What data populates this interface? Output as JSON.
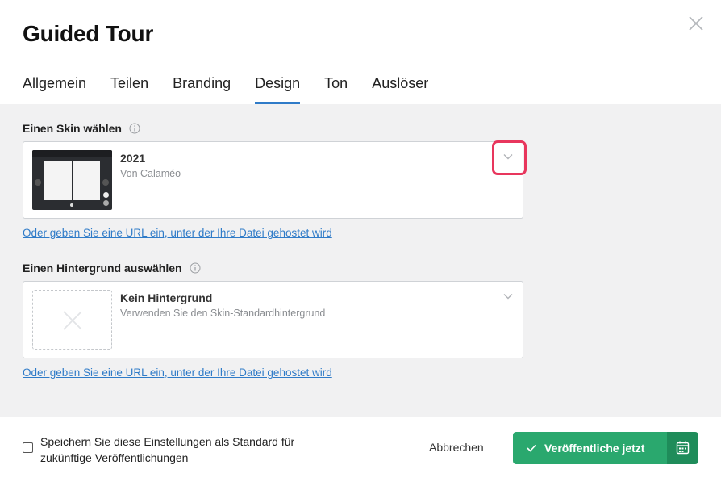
{
  "dialog": {
    "title": "Guided Tour"
  },
  "tabs": [
    {
      "label": "Allgemein"
    },
    {
      "label": "Teilen"
    },
    {
      "label": "Branding"
    },
    {
      "label": "Design",
      "active": true
    },
    {
      "label": "Ton"
    },
    {
      "label": "Auslöser"
    }
  ],
  "skin": {
    "label": "Einen Skin wählen",
    "selected_title": "2021",
    "selected_subtitle": "Von Calaméo",
    "url_link": "Oder geben Sie eine URL ein, unter der Ihre Datei gehostet wird"
  },
  "background": {
    "label": "Einen Hintergrund auswählen",
    "selected_title": "Kein Hintergrund",
    "selected_subtitle": "Verwenden Sie den Skin-Standardhintergrund",
    "url_link": "Oder geben Sie eine URL ein, unter der Ihre Datei gehostet wird"
  },
  "footer": {
    "save_default_label": "Speichern Sie diese Einstellungen als Standard für zukünftige Veröffentlichungen",
    "save_default_checked": false,
    "cancel_label": "Abbrechen",
    "publish_label": "Veröffentliche jetzt"
  },
  "colors": {
    "accent": "#2f7bc8",
    "publish": "#2aa86e",
    "publish_dark": "#1f8c5a",
    "highlight": "#e8365d"
  },
  "icons": [
    "close-icon",
    "info-icon",
    "chevron-down-icon",
    "placeholder-x-icon",
    "check-icon",
    "calendar-icon"
  ]
}
